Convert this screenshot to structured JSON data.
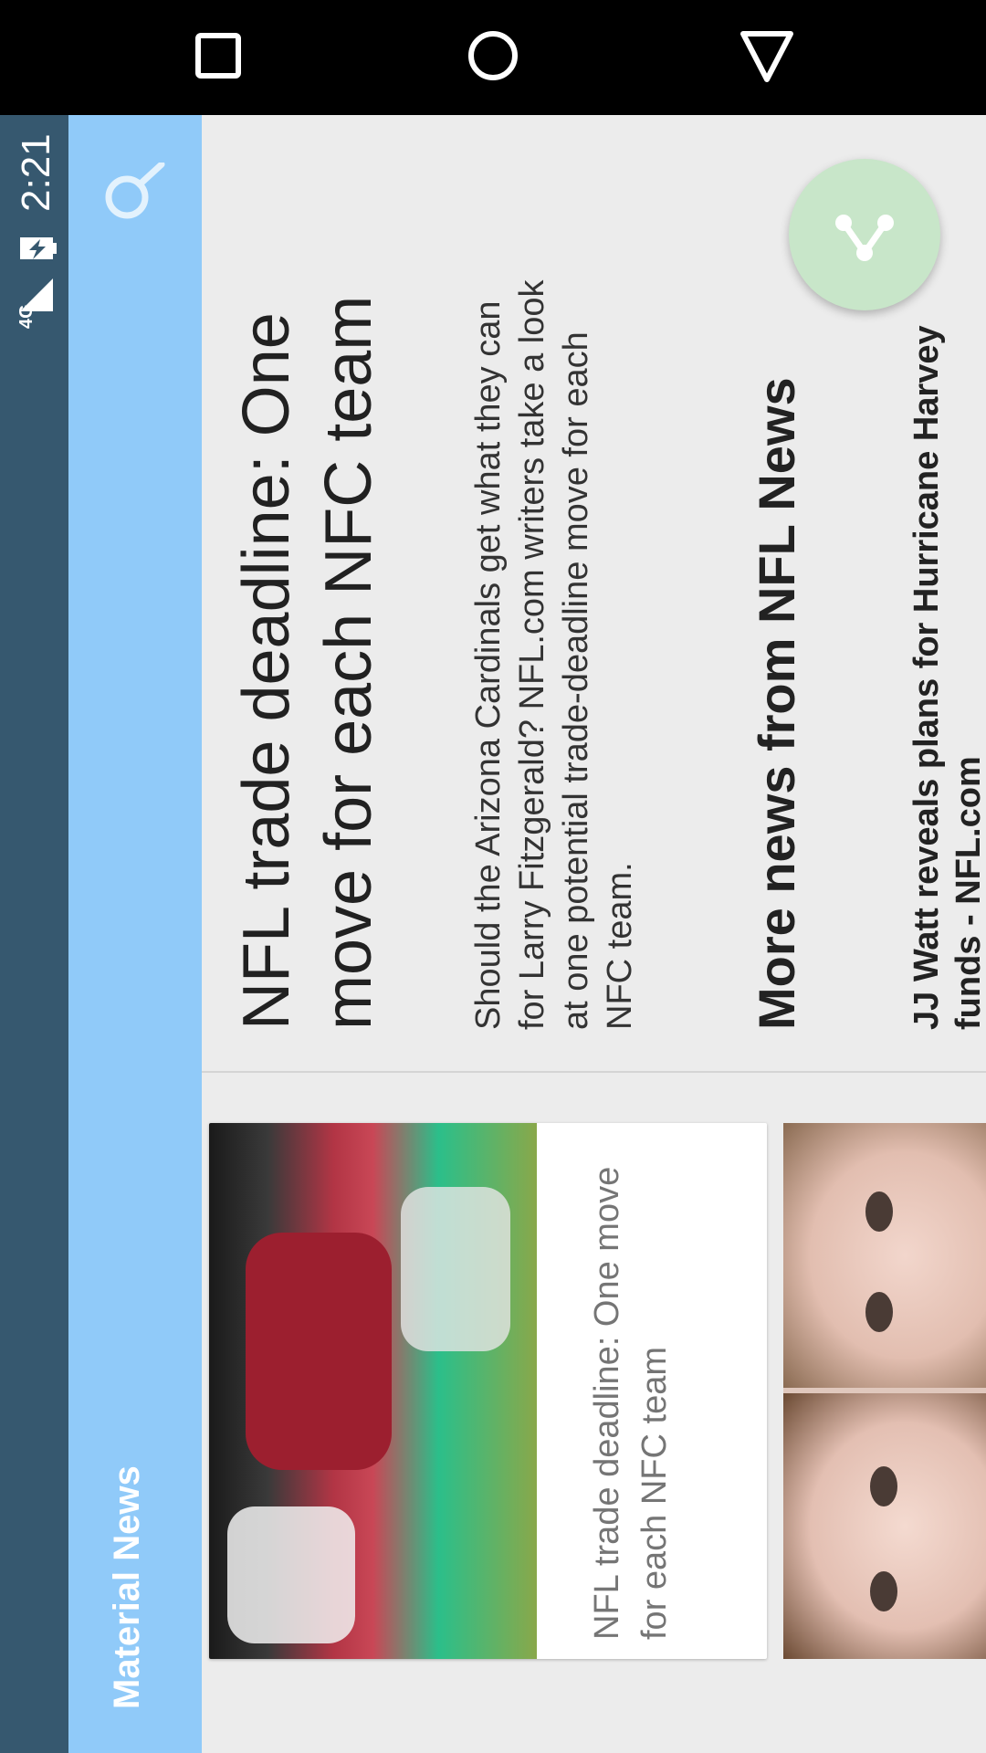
{
  "status_bar": {
    "time": "2:21",
    "network": "4G"
  },
  "app_bar": {
    "title": "Material News"
  },
  "article": {
    "headline": [
      "NFL trade deadline: One",
      "move for each NFC team"
    ],
    "summary": [
      "Should the Arizona Cardinals get what they can",
      "for Larry Fitzgerald? NFL.com writers take a look",
      "at one potential trade-deadline move for each",
      "NFC team."
    ],
    "more_heading": "More news from NFL News",
    "more_item": [
      "JJ Watt reveals plans for Hurricane Harvey",
      "funds - NFL.com"
    ]
  },
  "cards": [
    {
      "caption": [
        "NFL trade deadline: One move",
        "for each NFC team"
      ]
    }
  ],
  "colors": {
    "status_bar": "#36586f",
    "app_bar": "#90caf9",
    "fab": "#c8e6c9",
    "background": "#ececec"
  },
  "icons": {
    "nav_recent": "square-icon",
    "nav_home": "circle-icon",
    "nav_back": "triangle-back-icon",
    "search": "search-icon",
    "share": "share-icon"
  }
}
